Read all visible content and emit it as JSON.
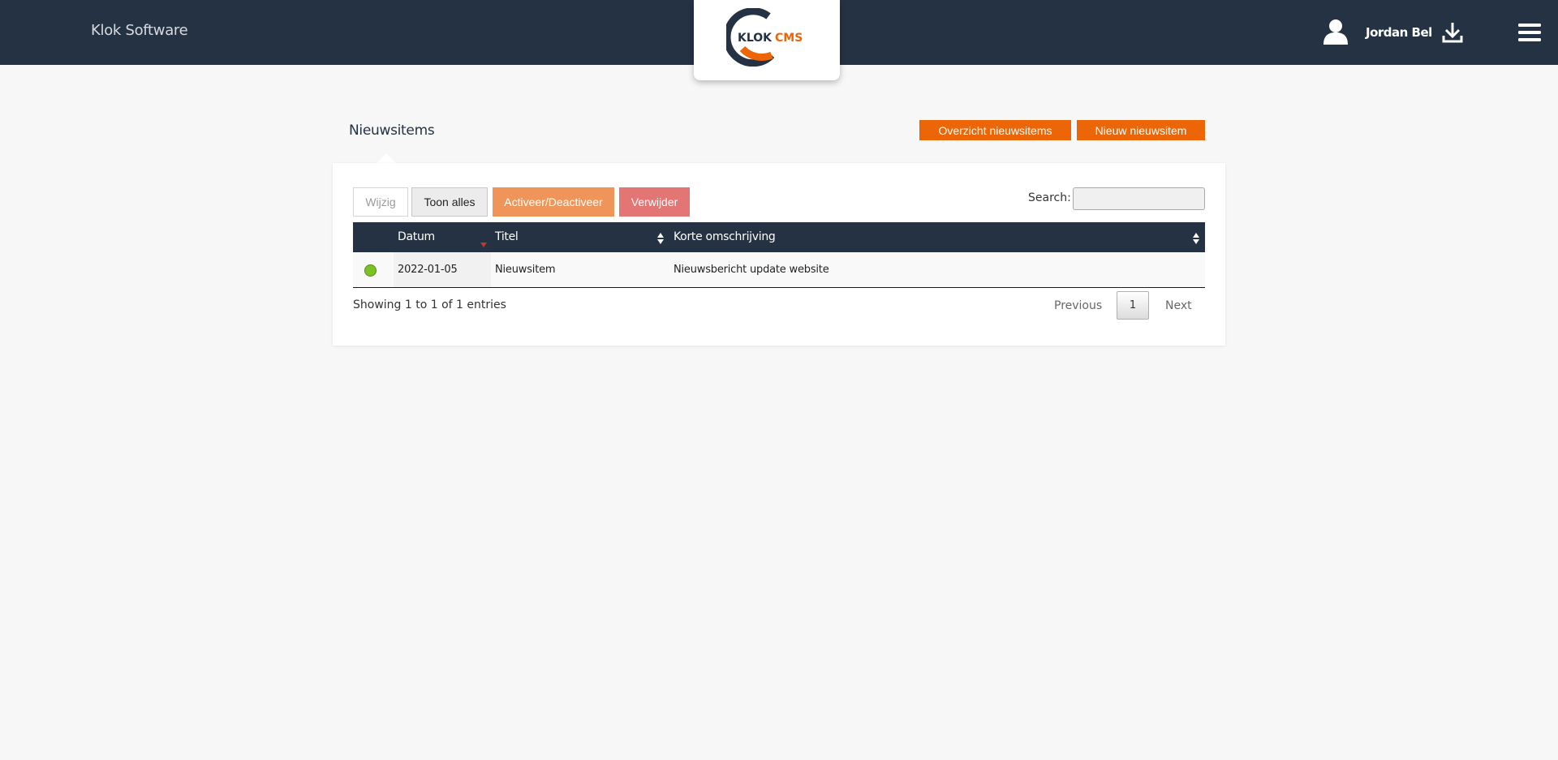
{
  "header": {
    "brand": "Klok Software",
    "logo": {
      "word1": "KLOK",
      "word2": "CMS"
    },
    "user_name": "Jordan Bel",
    "icons": [
      "user-icon",
      "download-icon",
      "hamburger-menu-icon"
    ]
  },
  "page": {
    "title": "Nieuwsitems",
    "buttons": {
      "overview": "Overzicht nieuwsitems",
      "new": "Nieuw nieuwsitem"
    }
  },
  "toolbar": {
    "edit": "Wijzig",
    "show_all": "Toon alles",
    "toggle_active": "Activeer/Deactiveer",
    "delete": "Verwijder",
    "search_label": "Search:",
    "search_value": ""
  },
  "table": {
    "columns": [
      "",
      "Datum",
      "Titel",
      "Korte omschrijving"
    ],
    "rows": [
      {
        "status": "active",
        "datum": "2022-01-05",
        "titel": "Nieuwsitem",
        "omschrijving": "Nieuwsbericht update website"
      }
    ],
    "info": "Showing 1 to 1 of 1 entries",
    "pagination": {
      "previous": "Previous",
      "current": "1",
      "next": "Next"
    }
  },
  "colors": {
    "header_bg": "#253243",
    "accent_orange": "#ec6608",
    "activate_btn": "#f0955a",
    "delete_btn": "#e47575",
    "status_active": "#7ac122",
    "page_bg": "#f7f7f7"
  }
}
